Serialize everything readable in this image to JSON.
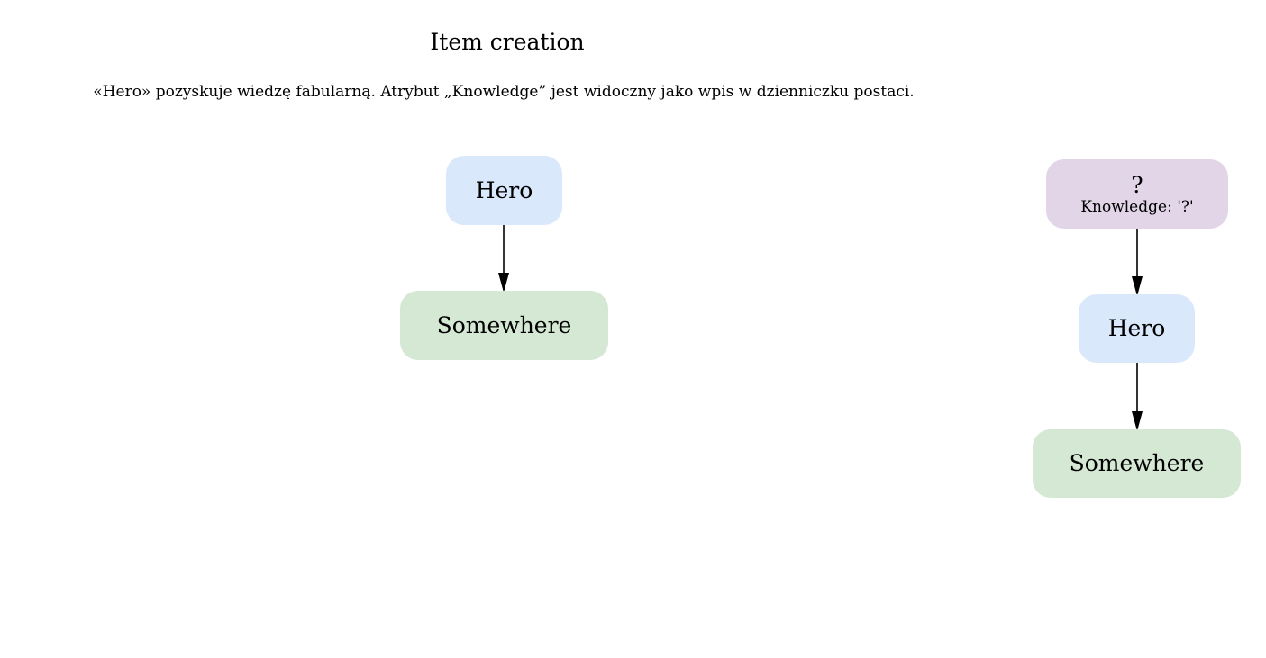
{
  "diagram": {
    "title": "Item creation",
    "subtitle": "«Hero» pozyskuje wiedzę fabularną. Atrybut „Knowledge” jest widoczny jako wpis w dzienniczku postaci.",
    "colors": {
      "character": "#dae8fc",
      "location": "#d5e8d4",
      "knowledge": "#e1d5e7",
      "edge": "#000000"
    },
    "left": {
      "hero": "Hero",
      "location": "Somewhere"
    },
    "right": {
      "item": "?",
      "item_attribute": "Knowledge: '?'",
      "hero": "Hero",
      "location": "Somewhere"
    },
    "edges": [
      {
        "from": "left.hero",
        "to": "left.location"
      },
      {
        "from": "right.item",
        "to": "right.hero"
      },
      {
        "from": "right.hero",
        "to": "right.location"
      }
    ]
  }
}
